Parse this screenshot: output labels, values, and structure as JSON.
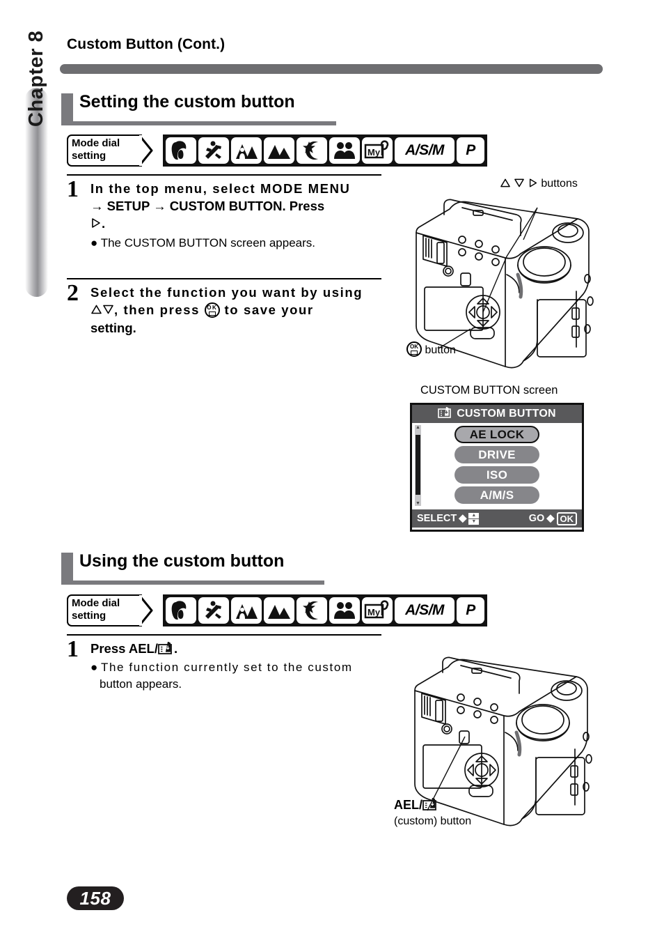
{
  "page": {
    "title": "Custom Button (Cont.)",
    "chapter_label": "Chapter 8",
    "page_number": "158",
    "accent_gray": "#7a7a7e",
    "rule_gray": "#6e6e71",
    "lcd_gray": "#59595b"
  },
  "mode_dial": {
    "flag_label": "Mode dial\nsetting",
    "icons": [
      {
        "name": "portrait-mode-icon",
        "label": ""
      },
      {
        "name": "sports-mode-icon",
        "label": ""
      },
      {
        "name": "landscape-portrait-mode-icon",
        "label": ""
      },
      {
        "name": "landscape-mode-icon",
        "label": ""
      },
      {
        "name": "night-scene-mode-icon",
        "label": ""
      },
      {
        "name": "self-portrait-mode-icon",
        "label": ""
      },
      {
        "name": "my-mode-icon",
        "label": "My"
      },
      {
        "name": "asm-mode-icon",
        "label": "A/S/M"
      },
      {
        "name": "p-mode-icon",
        "label": "P"
      }
    ]
  },
  "section1": {
    "heading": "Setting the custom button",
    "steps": [
      {
        "number": "1",
        "line1": "In the top menu, select MODE MENU",
        "line2_a": "SETUP",
        "line2_b": "CUSTOM BUTTON. Press",
        "line3": ".",
        "bullet": "The CUSTOM BUTTON screen appears."
      },
      {
        "number": "2",
        "line1": "Select the function you want by using",
        "line2_a": ", then press",
        "line2_b": "to save your",
        "line3": "setting."
      }
    ],
    "camera_callouts": {
      "arrow_buttons": "buttons",
      "ok_button": "button"
    },
    "lcd": {
      "caption_a": "CUSTOM BUTTON",
      "caption_b": "screen",
      "header_title": "CUSTOM BUTTON",
      "header_icon": "setup-card-icon",
      "items": [
        {
          "label": "AE LOCK",
          "selected": true
        },
        {
          "label": "DRIVE",
          "selected": false
        },
        {
          "label": "ISO",
          "selected": false
        },
        {
          "label": "A/M/S",
          "selected": false
        }
      ],
      "footer": {
        "select_label": "SELECT",
        "select_arrow": "◆",
        "go_label": "GO",
        "go_arrow": "◆",
        "ok_label": "OK"
      }
    }
  },
  "section2": {
    "heading": "Using the custom button",
    "step": {
      "number": "1",
      "line1_a": "Press AEL/",
      "line1_b": ".",
      "bullet_l1": "The function currently set to the custom",
      "bullet_l2": "button appears."
    },
    "camera_callouts": {
      "ael_label": "AEL/",
      "custom_label": "(custom) button"
    }
  }
}
